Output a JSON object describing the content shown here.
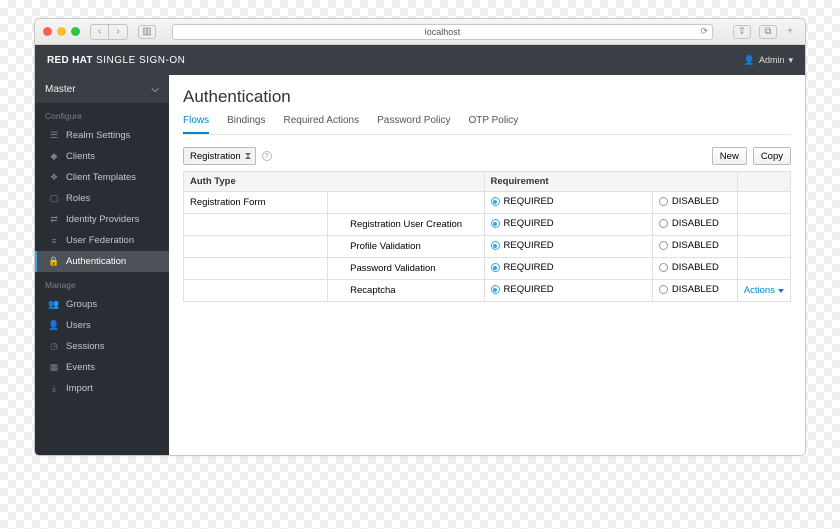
{
  "chrome": {
    "url": "localhost"
  },
  "header": {
    "brand_bold": "RED HAT",
    "brand_rest": "SINGLE SIGN-ON",
    "user": "Admin"
  },
  "sidebar": {
    "realm": "Master",
    "sections": [
      {
        "title": "Configure",
        "items": [
          "Realm Settings",
          "Clients",
          "Client Templates",
          "Roles",
          "Identity Providers",
          "User Federation",
          "Authentication"
        ]
      },
      {
        "title": "Manage",
        "items": [
          "Groups",
          "Users",
          "Sessions",
          "Events",
          "Import"
        ]
      }
    ]
  },
  "main": {
    "title": "Authentication",
    "tabs": [
      "Flows",
      "Bindings",
      "Required Actions",
      "Password Policy",
      "OTP Policy"
    ],
    "flow_select": "Registration",
    "buttons": {
      "new": "New",
      "copy": "Copy"
    },
    "columns": [
      "Auth Type",
      "Requirement"
    ],
    "req_labels": {
      "required": "REQUIRED",
      "disabled": "DISABLED"
    },
    "actions_label": "Actions",
    "rows": [
      {
        "indent": 0,
        "name": "Registration Form",
        "selected": "required",
        "actions": false
      },
      {
        "indent": 1,
        "name": "Registration User Creation",
        "selected": "required",
        "actions": false
      },
      {
        "indent": 1,
        "name": "Profile Validation",
        "selected": "required",
        "actions": false
      },
      {
        "indent": 1,
        "name": "Password Validation",
        "selected": "required",
        "actions": false
      },
      {
        "indent": 1,
        "name": "Recaptcha",
        "selected": "required",
        "actions": true
      }
    ]
  }
}
